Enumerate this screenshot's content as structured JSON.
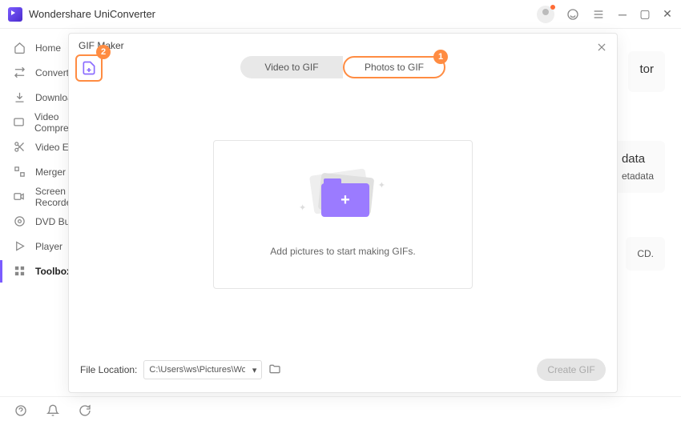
{
  "app": {
    "title": "Wondershare UniConverter"
  },
  "sidebar": {
    "items": [
      {
        "label": "Home"
      },
      {
        "label": "Converter"
      },
      {
        "label": "Downloader"
      },
      {
        "label": "Video Compressor"
      },
      {
        "label": "Video Editor"
      },
      {
        "label": "Merger"
      },
      {
        "label": "Screen Recorder"
      },
      {
        "label": "DVD Burner"
      },
      {
        "label": "Player"
      },
      {
        "label": "Toolbox"
      }
    ]
  },
  "bg": {
    "card1_title": "tor",
    "card2_title": "data",
    "card2_sub": "etadata",
    "card3_sub": "CD."
  },
  "modal": {
    "title": "GIF Maker",
    "tabs": {
      "left": "Video to GIF",
      "right": "Photos to GIF"
    },
    "badges": {
      "addbtn": "2",
      "tab": "1"
    },
    "drop_text": "Add pictures to start making GIFs.",
    "file_location_label": "File Location:",
    "file_location_value": "C:\\Users\\ws\\Pictures\\Wonders",
    "create_label": "Create GIF"
  }
}
